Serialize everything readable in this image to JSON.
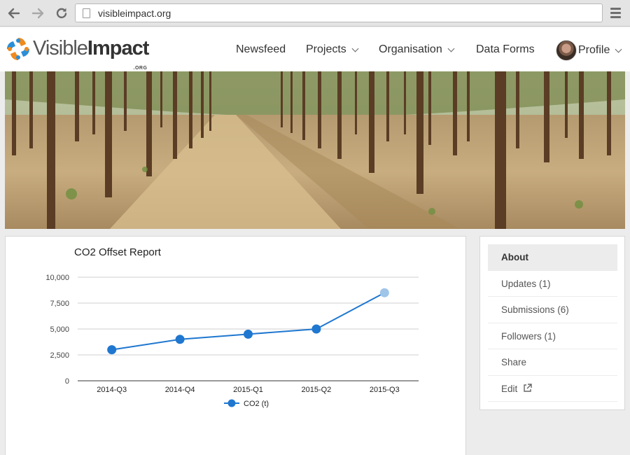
{
  "browser": {
    "url": "visibleimpact.org",
    "icons": [
      "back-arrow-icon",
      "forward-arrow-icon",
      "reload-icon",
      "page-icon",
      "hamburger-menu-icon"
    ]
  },
  "site": {
    "logo": {
      "visible": "Visible",
      "impact": "Impact",
      "org": ".ORG"
    },
    "nav": [
      {
        "label": "Newsfeed",
        "dropdown": false
      },
      {
        "label": "Projects",
        "dropdown": true
      },
      {
        "label": "Organisation",
        "dropdown": true
      },
      {
        "label": "Data Forms",
        "dropdown": false
      },
      {
        "label": "Profile",
        "dropdown": true
      }
    ],
    "colors": {
      "accent": "#1f77d0",
      "light_point": "#9fc5e8"
    }
  },
  "chart": {
    "title": "CO2 Offset Report",
    "legend_label": "CO2 (t)"
  },
  "chart_data": {
    "type": "line",
    "title": "CO2 Offset Report",
    "categories": [
      "2014-Q3",
      "2014-Q4",
      "2015-Q1",
      "2015-Q2",
      "2015-Q3"
    ],
    "series": [
      {
        "name": "CO2 (t)",
        "values": [
          3000,
          4000,
          4500,
          5000,
          8500
        ]
      }
    ],
    "ylim": [
      0,
      10000
    ],
    "yticks": [
      "0",
      "2,500",
      "5,000",
      "7,500",
      "10,000"
    ],
    "ytick_values": [
      0,
      2500,
      5000,
      7500,
      10000
    ],
    "grid": true,
    "legend": "bottom"
  },
  "sidebar": {
    "items": [
      {
        "label": "About",
        "active": true
      },
      {
        "label": "Updates (1)",
        "active": false
      },
      {
        "label": "Submissions (6)",
        "active": false
      },
      {
        "label": "Followers (1)",
        "active": false
      },
      {
        "label": "Share",
        "active": false
      },
      {
        "label": "Edit",
        "active": false,
        "icon": "external-link-icon"
      }
    ]
  }
}
